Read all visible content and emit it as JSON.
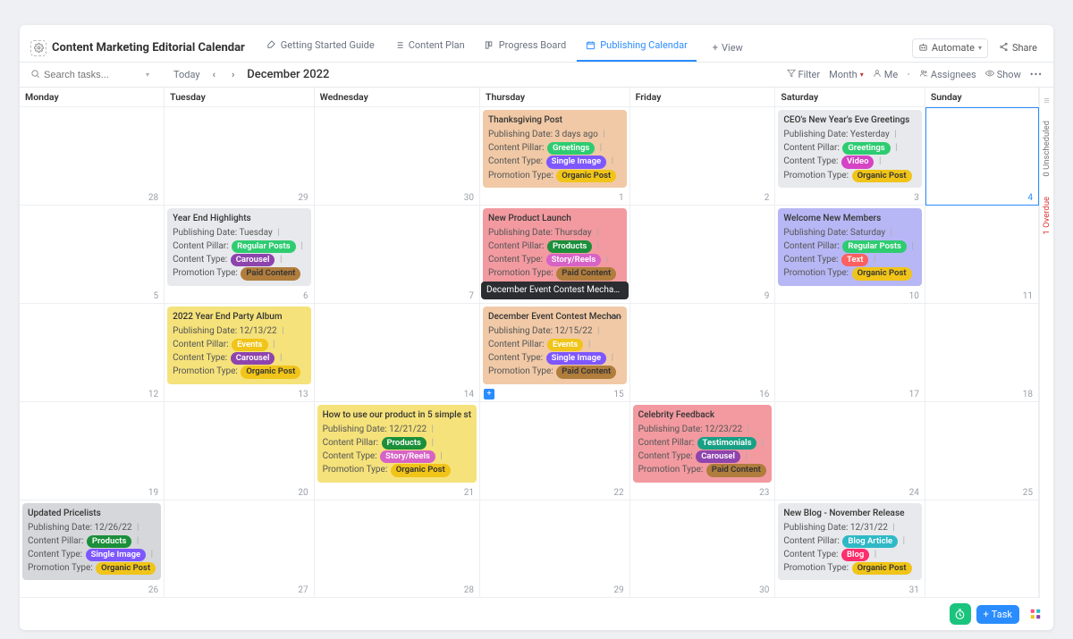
{
  "header": {
    "title": "Content Marketing Editorial Calendar",
    "tabs": [
      {
        "label": "Getting Started Guide"
      },
      {
        "label": "Content Plan"
      },
      {
        "label": "Progress Board"
      },
      {
        "label": "Publishing Calendar",
        "active": true
      }
    ],
    "view": "View",
    "automate": "Automate",
    "share": "Share"
  },
  "toolbar": {
    "search_placeholder": "Search tasks...",
    "today": "Today",
    "month_year": "December 2022",
    "filter": "Filter",
    "period": "Month",
    "me": "Me",
    "assignees": "Assignees",
    "show": "Show"
  },
  "calendar": {
    "days_of_week": [
      "Monday",
      "Tuesday",
      "Wednesday",
      "Thursday",
      "Friday",
      "Saturday",
      "Sunday"
    ],
    "labels": {
      "publishing_date": "Publishing Date:",
      "content_pillar": "Content Pillar:",
      "content_type": "Content Type:",
      "promotion_type": "Promotion Type:"
    },
    "tag_colors": {
      "Greetings": "#2ecc71",
      "Single Image": "#7e57ff",
      "Organic Post": "#f0c419",
      "Video": "#d444c5",
      "Regular Posts": "#2ecc71",
      "Carousel": "#8e44ad",
      "Paid Content": "#b07d3d",
      "Products": "#1b8f3a",
      "Story/Reels": "#d763c6",
      "Text": "#ff5f5f",
      "Events": "#f0c419",
      "Testimonials": "#18a085",
      "Blog Article": "#2fb9c6",
      "Blog": "#ff2e6c"
    },
    "weeks": [
      [
        {
          "d": "28",
          "cards": []
        },
        {
          "d": "29",
          "cards": []
        },
        {
          "d": "30",
          "cards": []
        },
        {
          "d": "1",
          "cards": [
            {
              "bg": "#f1c9a6",
              "title": "Thanksgiving Post",
              "date": "3 days ago",
              "pillar": "Greetings",
              "type": "Single Image",
              "promo": "Organic Post"
            }
          ]
        },
        {
          "d": "2",
          "cards": []
        },
        {
          "d": "3",
          "cards": [
            {
              "bg": "#e7e9ec",
              "title": "CEO's New Year's Eve Greetings",
              "date": "Yesterday",
              "pillar": "Greetings",
              "type": "Video",
              "promo": "Organic Post"
            }
          ]
        },
        {
          "d": "4",
          "cards": [],
          "sunday": true
        }
      ],
      [
        {
          "d": "5",
          "cards": []
        },
        {
          "d": "6",
          "cards": [
            {
              "bg": "#e7e9ec",
              "title": "Year End Highlights",
              "date": "Tuesday",
              "pillar": "Regular Posts",
              "type": "Carousel",
              "promo": "Paid Content"
            }
          ]
        },
        {
          "d": "7",
          "cards": []
        },
        {
          "d": "8",
          "cards": [
            {
              "bg": "#f29aa0",
              "title": "New Product Launch",
              "date": "Thursday",
              "pillar": "Products",
              "type": "Story/Reels",
              "promo": "Paid Content",
              "tooltip": "December Event Contest Mechanics"
            }
          ]
        },
        {
          "d": "9",
          "cards": []
        },
        {
          "d": "10",
          "cards": [
            {
              "bg": "#b7b7f5",
              "title": "Welcome New Members",
              "date": "Saturday",
              "pillar": "Regular Posts",
              "type": "Text",
              "promo": "Organic Post"
            }
          ]
        },
        {
          "d": "11",
          "cards": []
        }
      ],
      [
        {
          "d": "12",
          "cards": []
        },
        {
          "d": "13",
          "cards": [
            {
              "bg": "#f5e27a",
              "title": "2022 Year End Party Album",
              "date": "12/13/22",
              "pillar": "Events",
              "type": "Carousel",
              "promo": "Organic Post"
            }
          ]
        },
        {
          "d": "14",
          "cards": []
        },
        {
          "d": "15",
          "show_add": true,
          "cards": [
            {
              "bg": "#f1c9a6",
              "title": "December Event Contest Mechan",
              "date": "12/15/22",
              "pillar": "Events",
              "type": "Single Image",
              "promo": "Paid Content",
              "show_more": true
            }
          ]
        },
        {
          "d": "16",
          "cards": []
        },
        {
          "d": "17",
          "cards": []
        },
        {
          "d": "18",
          "cards": []
        }
      ],
      [
        {
          "d": "19",
          "cards": []
        },
        {
          "d": "20",
          "cards": []
        },
        {
          "d": "21",
          "cards": [
            {
              "bg": "#f5e27a",
              "title": "How to use our product in 5 simple st",
              "date": "12/21/22",
              "pillar": "Products",
              "type": "Story/Reels",
              "promo": "Organic Post"
            }
          ]
        },
        {
          "d": "22",
          "cards": []
        },
        {
          "d": "23",
          "cards": [
            {
              "bg": "#f29aa0",
              "title": "Celebrity Feedback",
              "date": "12/23/22",
              "pillar": "Testimonials",
              "type": "Carousel",
              "promo": "Paid Content"
            }
          ]
        },
        {
          "d": "24",
          "cards": []
        },
        {
          "d": "25",
          "cards": []
        }
      ],
      [
        {
          "d": "26",
          "cards": [
            {
              "bg": "#d5d7da",
              "title": "Updated Pricelists",
              "date": "12/26/22",
              "pillar": "Products",
              "type": "Single Image",
              "promo": "Organic Post"
            }
          ]
        },
        {
          "d": "27",
          "cards": []
        },
        {
          "d": "28",
          "cards": []
        },
        {
          "d": "29",
          "cards": []
        },
        {
          "d": "30",
          "cards": []
        },
        {
          "d": "31",
          "cards": [
            {
              "bg": "#e7e9ec",
              "title": "New Blog - November Release",
              "date": "12/31/22",
              "pillar": "Blog Article",
              "type": "Blog",
              "promo": "Organic Post"
            }
          ]
        },
        {
          "d": "",
          "cards": []
        }
      ]
    ]
  },
  "rail": {
    "unscheduled": "0 Unscheduled",
    "overdue": "1 Overdue"
  },
  "footer": {
    "task": "Task"
  }
}
